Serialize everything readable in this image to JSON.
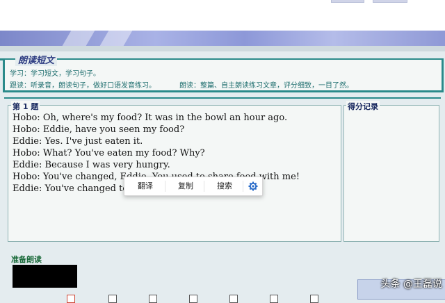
{
  "intro": {
    "title": "朗读短文",
    "learn": "学习：学习短文，学习句子。",
    "follow": "跟读：听录音，朗读句子，做好口语发音练习。",
    "read": "朗读：整篇、自主朗读练习文章，评分细致，一目了然。"
  },
  "question": {
    "label": "第 1 题",
    "lines": [
      "Hobo: Oh, where's my food? It was in the bowl an hour ago.",
      "Hobo: Eddie, have you seen my food?",
      "Eddie: Yes. I've just eaten it.",
      "Hobo: What? You've eaten my food? Why?",
      "Eddie: Because I was very hungry.",
      "Hobo: You've changed, Eddie. You used to share food with me!",
      "Eddie: You've changed to"
    ]
  },
  "score": {
    "label": "得分记录"
  },
  "context_menu": {
    "translate": "翻译",
    "copy": "复制",
    "search": "搜索",
    "settings_icon": "gear-icon"
  },
  "ready": {
    "label": "准备朗读"
  },
  "watermark": "头条 @王磊说"
}
